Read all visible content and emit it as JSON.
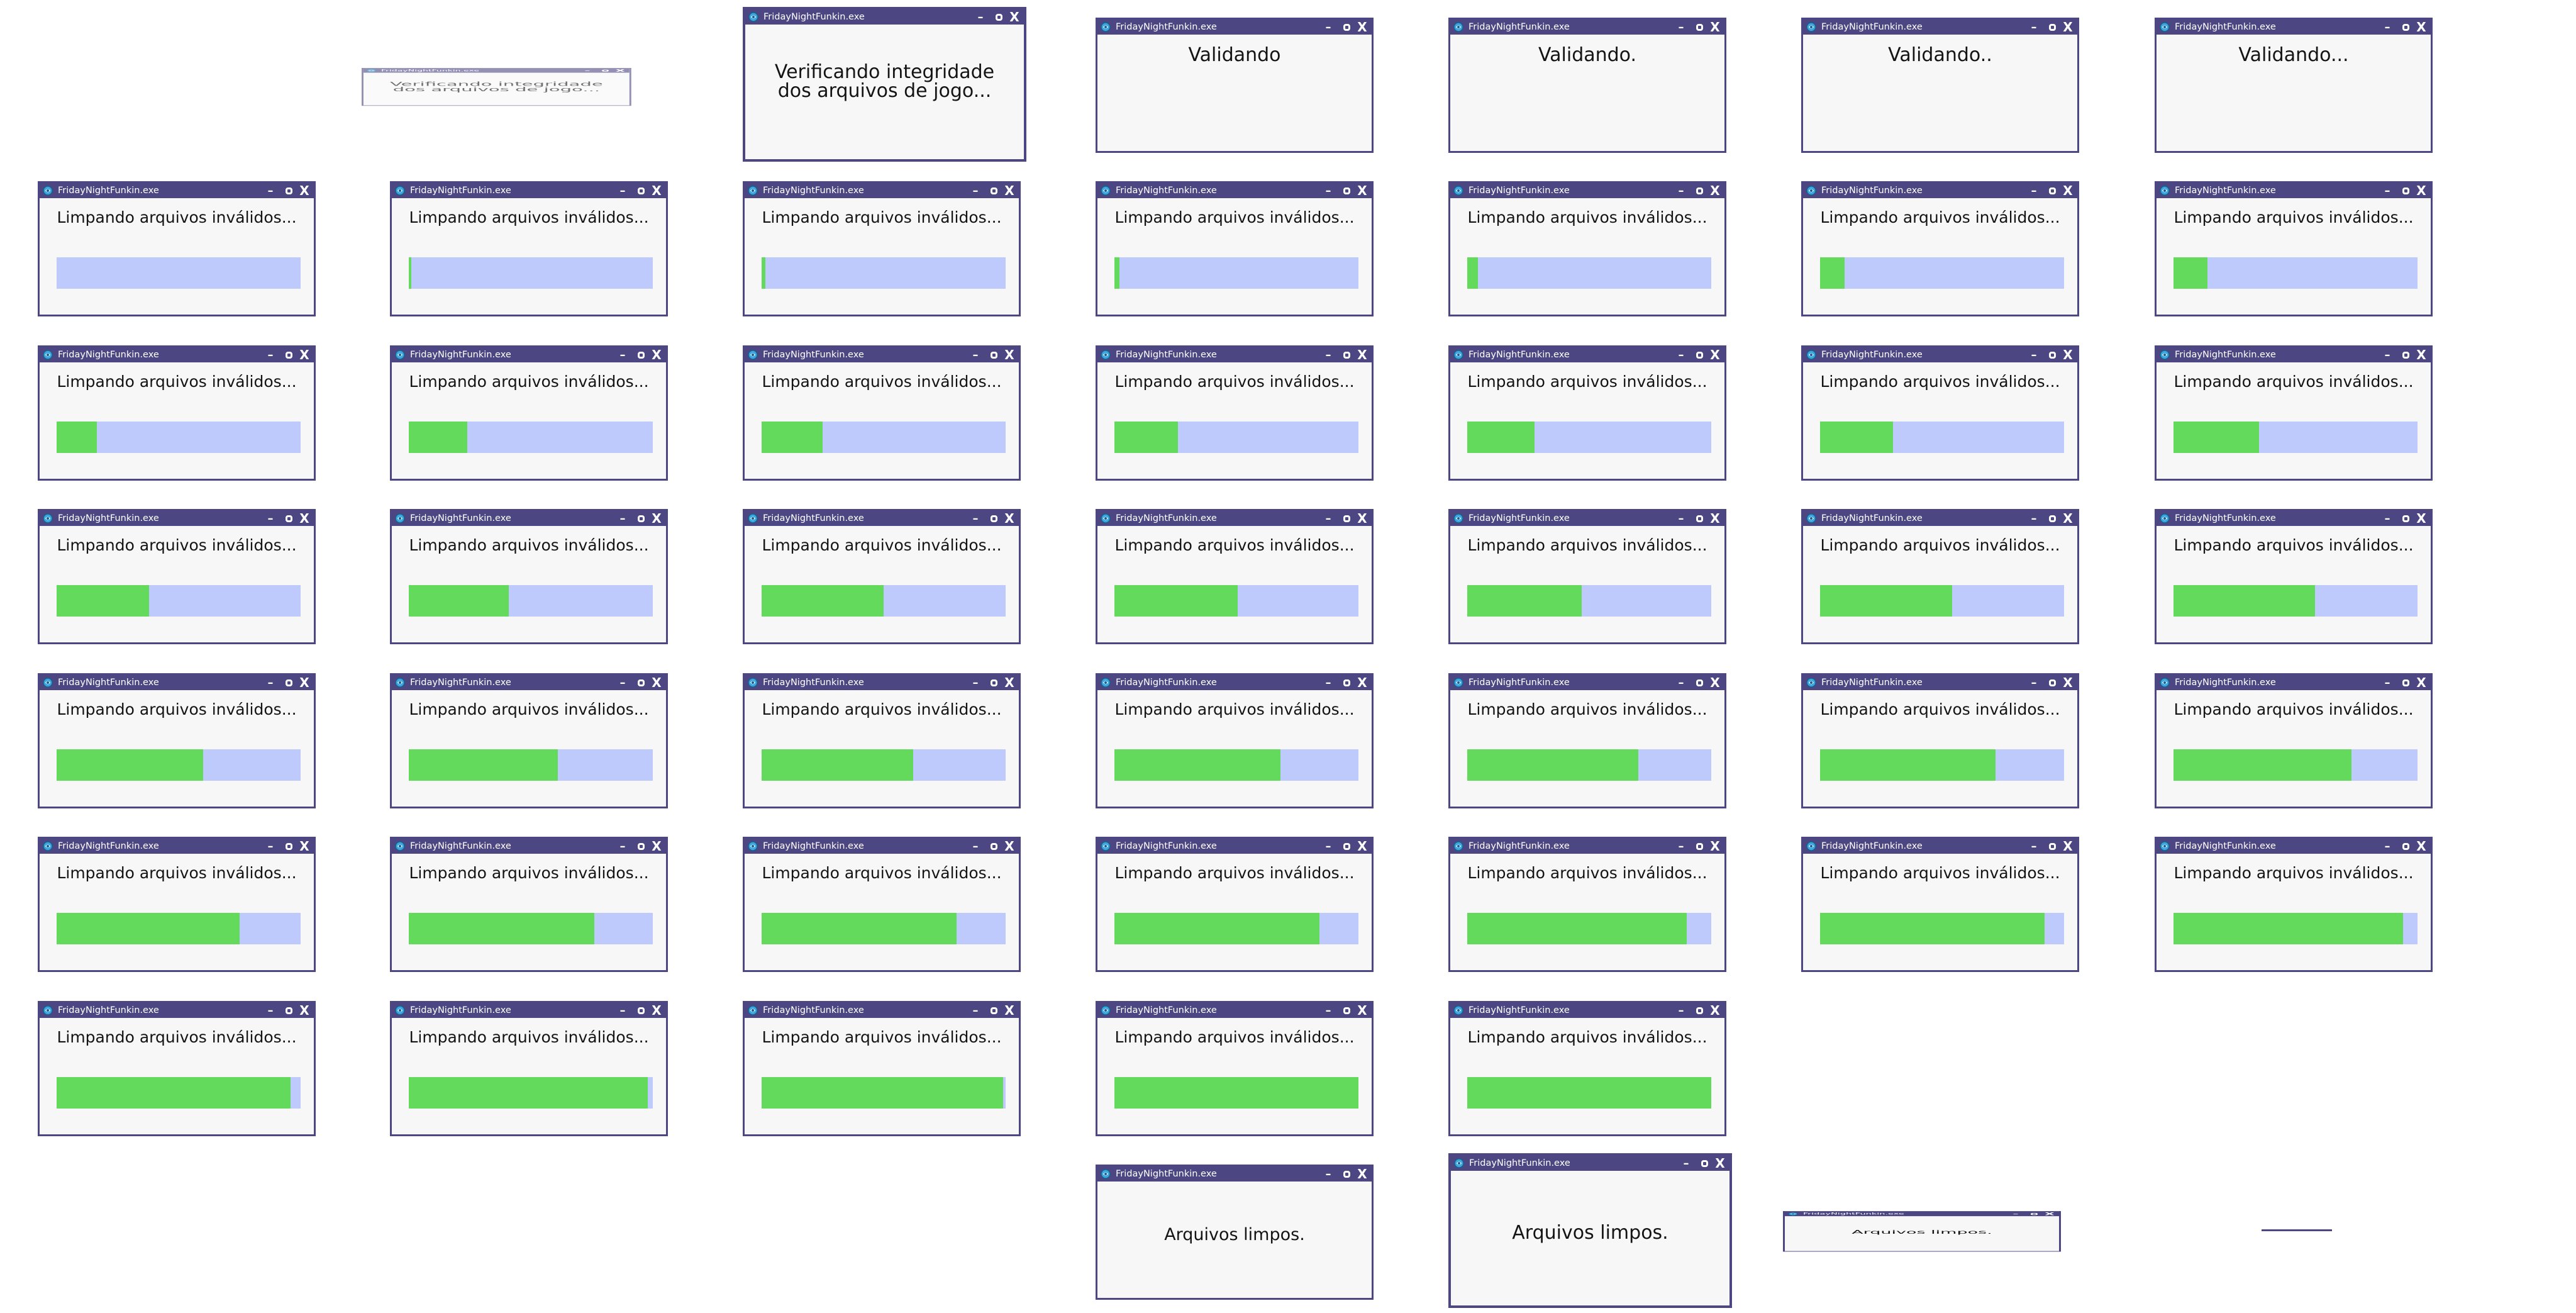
{
  "app_title": "FridayNightFunkin.exe",
  "icons": {
    "app": "fnf-app-icon",
    "minimize": "minimize-icon",
    "maximize": "maximize-icon",
    "close": "close-icon"
  },
  "controls": {
    "minimize": "–",
    "close": "X"
  },
  "messages": {
    "verifying": "Verificando integridade dos arquivos de jogo...",
    "validating": [
      "Validando",
      "Validando.",
      "Validando..",
      "Validando..."
    ],
    "cleaning": "Limpando arquivos inválidos...",
    "done": "Arquivos limpos."
  },
  "colors": {
    "titlebar": "#4c4782",
    "window_background": "#f7f7f8",
    "progress_track": "#bfcafc",
    "progress_fill": "#63da5b"
  },
  "frames": [
    {
      "kind": "verifying"
    },
    {
      "kind": "verifying"
    },
    {
      "kind": "validating",
      "step": 0
    },
    {
      "kind": "validating",
      "step": 1
    },
    {
      "kind": "validating",
      "step": 2
    },
    {
      "kind": "validating",
      "step": 3
    },
    {
      "kind": "cleaning",
      "progress": 0.0
    },
    {
      "kind": "cleaning",
      "progress": 0.01
    },
    {
      "kind": "cleaning",
      "progress": 0.015
    },
    {
      "kind": "cleaning",
      "progress": 0.02
    },
    {
      "kind": "cleaning",
      "progress": 0.045
    },
    {
      "kind": "cleaning",
      "progress": 0.1
    },
    {
      "kind": "cleaning",
      "progress": 0.14
    },
    {
      "kind": "cleaning",
      "progress": 0.165
    },
    {
      "kind": "cleaning",
      "progress": 0.24
    },
    {
      "kind": "cleaning",
      "progress": 0.25
    },
    {
      "kind": "cleaning",
      "progress": 0.26
    },
    {
      "kind": "cleaning",
      "progress": 0.275
    },
    {
      "kind": "cleaning",
      "progress": 0.3
    },
    {
      "kind": "cleaning",
      "progress": 0.35
    },
    {
      "kind": "cleaning",
      "progress": 0.38
    },
    {
      "kind": "cleaning",
      "progress": 0.41
    },
    {
      "kind": "cleaning",
      "progress": 0.5
    },
    {
      "kind": "cleaning",
      "progress": 0.505
    },
    {
      "kind": "cleaning",
      "progress": 0.47
    },
    {
      "kind": "cleaning",
      "progress": 0.54
    },
    {
      "kind": "cleaning",
      "progress": 0.58
    },
    {
      "kind": "cleaning",
      "progress": 0.6
    },
    {
      "kind": "cleaning",
      "progress": 0.61
    },
    {
      "kind": "cleaning",
      "progress": 0.62
    },
    {
      "kind": "cleaning",
      "progress": 0.68
    },
    {
      "kind": "cleaning",
      "progress": 0.7
    },
    {
      "kind": "cleaning",
      "progress": 0.72
    },
    {
      "kind": "cleaning",
      "progress": 0.73
    },
    {
      "kind": "cleaning",
      "progress": 0.75
    },
    {
      "kind": "cleaning",
      "progress": 0.76
    },
    {
      "kind": "cleaning",
      "progress": 0.8
    },
    {
      "kind": "cleaning",
      "progress": 0.84
    },
    {
      "kind": "cleaning",
      "progress": 0.9
    },
    {
      "kind": "cleaning",
      "progress": 0.92
    },
    {
      "kind": "cleaning",
      "progress": 0.94
    },
    {
      "kind": "cleaning",
      "progress": 0.96
    },
    {
      "kind": "cleaning",
      "progress": 0.98
    },
    {
      "kind": "cleaning",
      "progress": 0.99
    },
    {
      "kind": "cleaning",
      "progress": 1.0
    },
    {
      "kind": "cleaning",
      "progress": 1.0
    },
    {
      "kind": "done"
    },
    {
      "kind": "done"
    },
    {
      "kind": "done"
    },
    {
      "kind": "done"
    }
  ]
}
